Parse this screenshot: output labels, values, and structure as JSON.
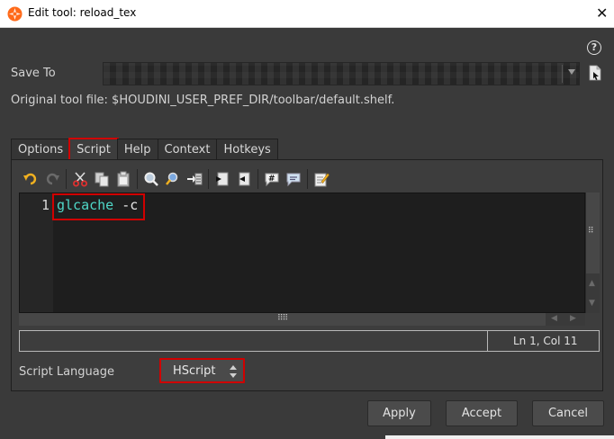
{
  "window": {
    "title": "Edit tool: reload_tex",
    "close_glyph": "✕",
    "icon": "houdini-logo-icon"
  },
  "help": {
    "glyph": "?"
  },
  "save_to": {
    "label": "Save To",
    "value": ""
  },
  "original_tool_file": "Original tool file: $HOUDINI_USER_PREF_DIR/toolbar/default.shelf.",
  "tabs": [
    {
      "label": "Options",
      "active": false
    },
    {
      "label": "Script",
      "active": true
    },
    {
      "label": "Help",
      "active": false
    },
    {
      "label": "Context",
      "active": false
    },
    {
      "label": "Hotkeys",
      "active": false
    }
  ],
  "toolbar": {
    "icons": [
      "undo-icon",
      "redo-icon",
      "cut-icon",
      "copy-icon",
      "paste-icon",
      "find-icon",
      "find-replace-icon",
      "goto-line-icon",
      "indent-icon",
      "unindent-icon",
      "comment-icon",
      "uncomment-icon",
      "edit-icon"
    ]
  },
  "editor": {
    "line_number": "1",
    "code_keyword": "glcache",
    "code_rest": " -c"
  },
  "status": {
    "position": "Ln 1, Col 11"
  },
  "script_language": {
    "label": "Script Language",
    "value": "HScript"
  },
  "buttons": {
    "apply": "Apply",
    "accept": "Accept",
    "cancel": "Cancel"
  },
  "colors": {
    "highlight": "#d00000",
    "keyword": "#4fd8c8",
    "background": "#3a3a3a"
  }
}
